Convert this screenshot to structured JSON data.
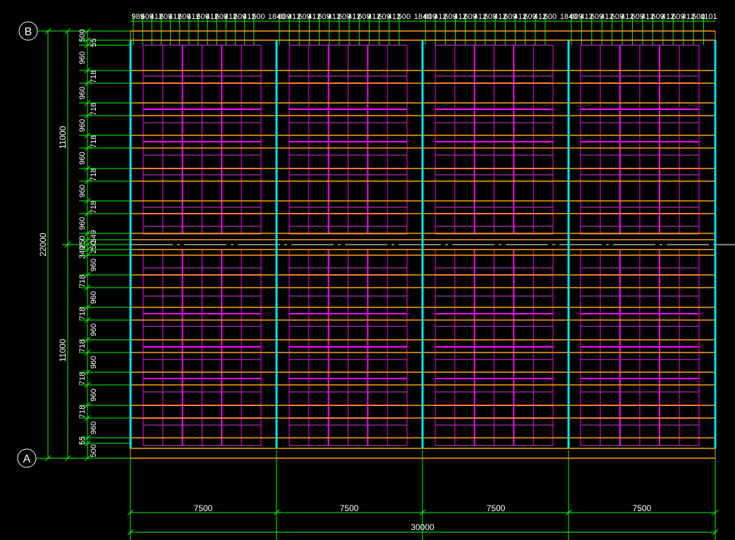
{
  "colors": {
    "background": "#000000",
    "dimension": "#00ff00",
    "column": "#00e5ee",
    "beam": "#ffa500",
    "rafter": "#ff00ff",
    "panel": "#cc44cc",
    "text": "#ffffff"
  },
  "axes": {
    "top_label": "B",
    "bottom_label": "A"
  },
  "bottom_dims": {
    "bays": [
      "7500",
      "7500",
      "7500",
      "7500"
    ],
    "total": "30000"
  },
  "left_dims": {
    "upper_half": "11000",
    "lower_half": "11000",
    "total": "22000",
    "row_labels": [
      "500",
      "55",
      "960",
      "718",
      "960",
      "718",
      "960",
      "718",
      "960",
      "718",
      "960",
      "718",
      "960",
      "349",
      "250",
      "250",
      "349",
      "960",
      "718",
      "960",
      "718",
      "960",
      "718",
      "960",
      "718",
      "960",
      "718",
      "960",
      "55",
      "500"
    ]
  },
  "top_dims": {
    "bays": [
      [
        "989",
        "609",
        "412",
        "609",
        "412",
        "609",
        "412",
        "609",
        "412",
        "609",
        "412",
        "609",
        "412",
        "500"
      ],
      [
        "609",
        "412",
        "609",
        "412",
        "609",
        "412",
        "609",
        "412",
        "609",
        "412",
        "609",
        "412",
        "500"
      ],
      [
        "609",
        "412",
        "609",
        "412",
        "609",
        "412",
        "609",
        "412",
        "609",
        "412",
        "609",
        "412",
        "500"
      ],
      [
        "609",
        "412",
        "609",
        "412",
        "609",
        "412",
        "609",
        "412",
        "609",
        "412",
        "609",
        "412",
        "500",
        "1101"
      ]
    ],
    "separators": [
      "1840",
      "1840",
      "1840"
    ]
  }
}
